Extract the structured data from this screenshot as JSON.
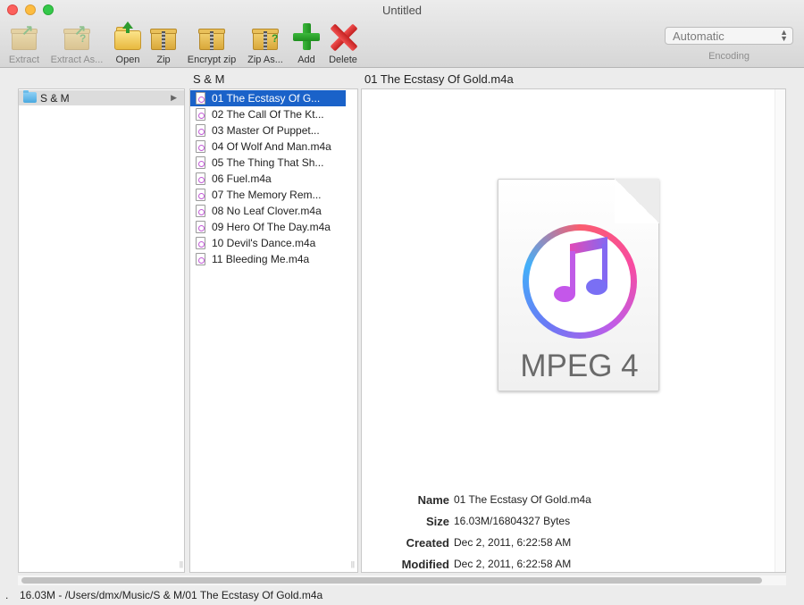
{
  "window": {
    "title": "Untitled"
  },
  "toolbar": {
    "buttons": [
      {
        "label": "Extract",
        "icon": "extract-box-icon",
        "enabled": false
      },
      {
        "label": "Extract As...",
        "icon": "extract-as-box-icon",
        "enabled": false
      },
      {
        "label": "Open",
        "icon": "open-folder-icon",
        "enabled": true
      },
      {
        "label": "Zip",
        "icon": "zip-box-icon",
        "enabled": true
      },
      {
        "label": "Encrypt zip",
        "icon": "encrypt-zip-icon",
        "enabled": true
      },
      {
        "label": "Zip As...",
        "icon": "zip-as-icon",
        "enabled": true
      },
      {
        "label": "Add",
        "icon": "add-plus-icon",
        "enabled": true
      },
      {
        "label": "Delete",
        "icon": "delete-x-icon",
        "enabled": true
      }
    ],
    "encoding": {
      "value": "Automatic",
      "label": "Encoding"
    }
  },
  "columns": {
    "col2_header": "S & M",
    "col3_header": "01 The Ecstasy Of Gold.m4a"
  },
  "folders": [
    {
      "label": "S & M",
      "selected": true
    }
  ],
  "files": [
    {
      "label": "01 The Ecstasy Of G...",
      "selected": true
    },
    {
      "label": "02 The Call Of The Kt...",
      "selected": false
    },
    {
      "label": "03 Master Of Puppet...",
      "selected": false
    },
    {
      "label": "04 Of Wolf And Man.m4a",
      "selected": false
    },
    {
      "label": "05 The Thing That Sh...",
      "selected": false
    },
    {
      "label": "06 Fuel.m4a",
      "selected": false
    },
    {
      "label": "07 The Memory Rem...",
      "selected": false
    },
    {
      "label": "08 No Leaf Clover.m4a",
      "selected": false
    },
    {
      "label": "09 Hero Of The Day.m4a",
      "selected": false
    },
    {
      "label": "10 Devil's Dance.m4a",
      "selected": false
    },
    {
      "label": "11 Bleeding Me.m4a",
      "selected": false
    }
  ],
  "preview": {
    "doc_type": "MPEG 4",
    "meta": [
      {
        "key": "Name",
        "value": "01 The Ecstasy Of Gold.m4a"
      },
      {
        "key": "Size",
        "value": "16.03M/16804327 Bytes"
      },
      {
        "key": "Created",
        "value": "Dec 2, 2011, 6:22:58 AM"
      },
      {
        "key": "Modified",
        "value": "Dec 2, 2011, 6:22:58 AM"
      }
    ]
  },
  "status": {
    "dot": ".",
    "text": "16.03M - /Users/dmx/Music/S & M/01 The Ecstasy Of Gold.m4a"
  },
  "colors": {
    "selection": "#1a62c9",
    "close": "#fc605c",
    "minimize": "#fdbc40",
    "maximize": "#34c84a"
  }
}
